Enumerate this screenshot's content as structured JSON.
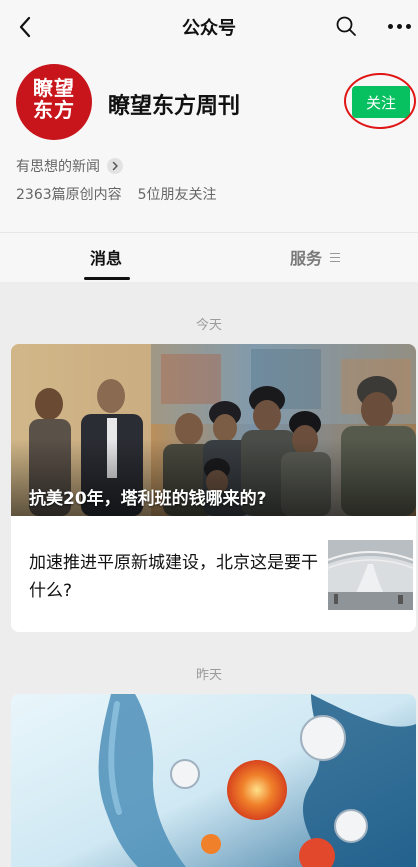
{
  "navbar": {
    "title": "公众号",
    "back_icon": "back-chevron-icon",
    "search_icon": "search-icon",
    "more_icon": "more-dots-icon"
  },
  "account": {
    "logo_text_line1": "瞭望",
    "logo_text_line2": "东方",
    "name": "瞭望东方周刊",
    "follow_label": "关注",
    "tagline": "有思想的新闻",
    "original_count": "2363篇原创内容",
    "friends_following": "5位朋友关注"
  },
  "tabs": [
    {
      "label": "消息",
      "active": true
    },
    {
      "label": "服务",
      "active": false
    }
  ],
  "feed": {
    "today_label": "今天",
    "today_hero_title": "抗美20年，塔利班的钱哪来的?",
    "today_item_title": "加速推进平原新城建设，北京这是要干什么?",
    "yesterday_label": "昨天"
  },
  "colors": {
    "follow_green": "#07c160",
    "logo_red": "#c8151b",
    "highlight_ring": "#e01515"
  }
}
